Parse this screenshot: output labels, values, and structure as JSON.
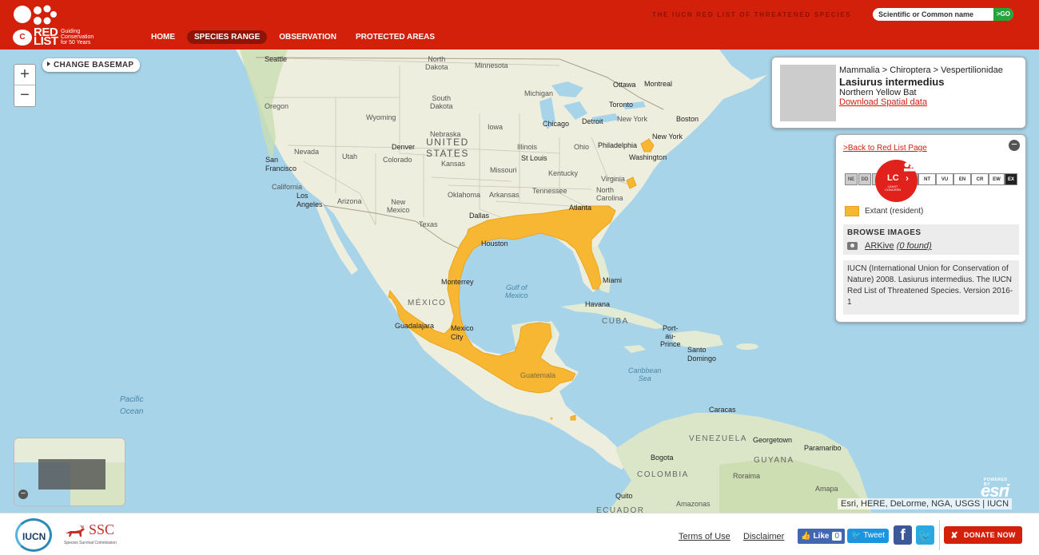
{
  "header": {
    "logo_text": "RED LIST",
    "logo_tagline": "Guiding Conservation for 50 Years",
    "tagline": "THE IUCN RED LIST OF THREATENED SPECIES",
    "nav": [
      "HOME",
      "SPECIES RANGE",
      "OBSERVATION",
      "PROTECTED AREAS"
    ],
    "active_nav": "SPECIES RANGE",
    "search_placeholder": "Scientific or Common name",
    "search_button": ">GO"
  },
  "map": {
    "zoom_in": "+",
    "zoom_out": "−",
    "basemap_button": "CHANGE BASEMAP",
    "attribution": "Esri, HERE, DeLorme, NGA, USGS | IUCN",
    "esri_label": "esri",
    "esri_powered": "POWERED BY",
    "range_color": "#f7b733",
    "labels": {
      "seattle": "Seattle",
      "north_dakota": "North\nDakota",
      "minnesota": "Minnesota",
      "oregon": "Oregon",
      "south_dakota": "South\nDakota",
      "wyoming": "Wyoming",
      "iowa": "Iowa",
      "nebraska": "Nebraska",
      "nevada": "Nevada",
      "utah": "Utah",
      "colorado": "Colorado",
      "kansas": "Kansas",
      "illinois": "Illinois",
      "missouri": "Missouri",
      "ohio": "Ohio",
      "kentucky": "Kentucky",
      "california": "California",
      "arizona": "Arizona",
      "new_mexico": "New\nMexico",
      "oklahoma": "Oklahoma",
      "arkansas": "Arkansas",
      "tennessee": "Tennessee",
      "virginia": "Virginia",
      "north_carolina": "North\nCarolina",
      "texas": "Texas",
      "michigan": "Michigan",
      "new_york_state": "New York",
      "ottawa": "Ottawa",
      "montreal": "Montreal",
      "toronto": "Toronto",
      "chicago": "Chicago",
      "detroit": "Detroit",
      "boston": "Boston",
      "new_york": "New York",
      "philadelphia": "Philadelphia",
      "washington": "Washington",
      "denver": "Denver",
      "st_louis": "St Louis",
      "san_francisco": "San\nFrancisco",
      "los_angeles": "Los\nAngeles",
      "dallas": "Dallas",
      "atlanta": "Atlanta",
      "houston": "Houston",
      "monterrey": "Monterrey",
      "miami": "Miami",
      "havana": "Havana",
      "guadalajara": "Guadalajara",
      "mexico_city": "Mexico\nCity",
      "port_au_prince": "Port-\nau-\nPrince",
      "santo_domingo": "Santo\nDomingo",
      "guatemala": "Guatemala",
      "caracas": "Caracas",
      "georgetown": "Georgetown",
      "paramaribo": "Paramaribo",
      "bogota": "Bogota",
      "quito": "Quito",
      "guyana": "GUYANA",
      "amapa": "Amapa",
      "roraima": "Roraima",
      "amazonas": "Amazonas",
      "united_states": "UNITED\nSTATES",
      "mexico": "MÉXICO",
      "cuba": "CUBA",
      "venezuela": "VENEZUELA",
      "colombia": "COLOMBIA",
      "ecuador": "ECUADOR",
      "gulf_of_mexico": "Gulf of\nMexico",
      "caribbean_sea": "Caribbean\nSea",
      "pacific_ocean": "Pacific\nOcean"
    }
  },
  "species": {
    "taxonomy": "Mammalia > Chiroptera > Vespertilionidae",
    "scientific_name": "Lasiurus intermedius",
    "common_name": "Northern Yellow Bat",
    "download_link": "Download Spatial data"
  },
  "legend": {
    "back_link": ">Back to Red List Page",
    "status_codes": [
      "NE",
      "DD",
      "LC",
      "NT",
      "VU",
      "EN",
      "CR",
      "EW",
      "EX"
    ],
    "current_status": "LC",
    "current_status_name": "LEAST CONCERN",
    "legend_label": "Extant (resident)",
    "browse_heading": "BROWSE IMAGES",
    "arkive_link": "ARKive",
    "arkive_found": "(0 found)",
    "citation": "IUCN (International Union for Conservation of Nature) 2008. Lasiurus intermedius. The IUCN Red List of Threatened Species. Version 2016-1"
  },
  "footer": {
    "iucn": "IUCN",
    "ssc": "SSC",
    "ssc_sub": "Species Survival Commission",
    "terms": "Terms of Use",
    "disclaimer": "Disclaimer",
    "fb_like": "Like",
    "fb_count": "0",
    "tweet": "Tweet",
    "donate": "DONATE NOW"
  }
}
